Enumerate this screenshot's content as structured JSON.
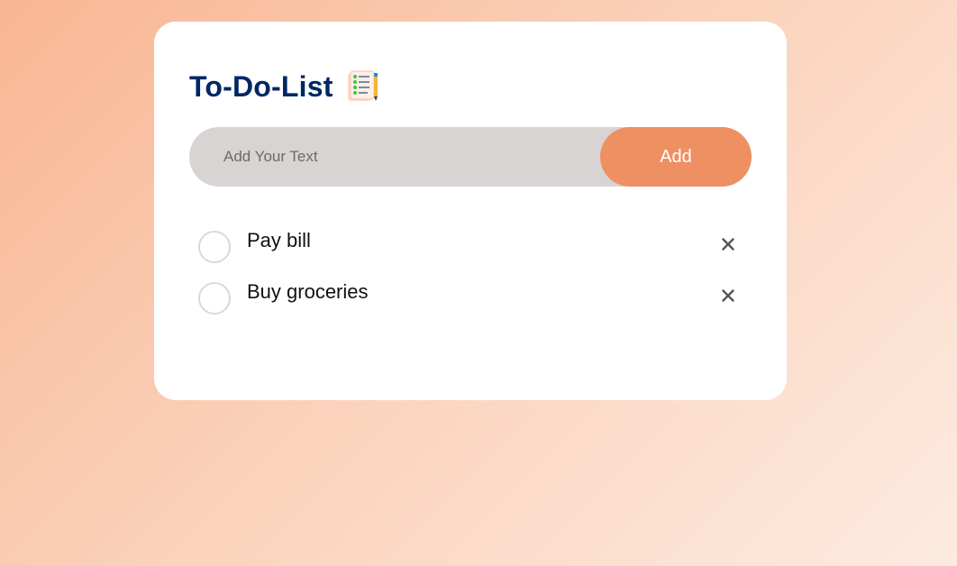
{
  "app": {
    "title": "To-Do-List",
    "title_icon": "checklist-notepad-icon"
  },
  "input": {
    "placeholder": "Add Your Text",
    "value": "",
    "add_label": "Add"
  },
  "tasks": [
    {
      "text": "Pay bill",
      "checked": false,
      "delete_icon": "close-icon"
    },
    {
      "text": "Buy groceries",
      "checked": false,
      "delete_icon": "close-icon"
    }
  ],
  "colors": {
    "title": "#002765",
    "accent": "#ee9062",
    "input_bg": "#d7d4d3",
    "card_bg": "#ffffff"
  }
}
